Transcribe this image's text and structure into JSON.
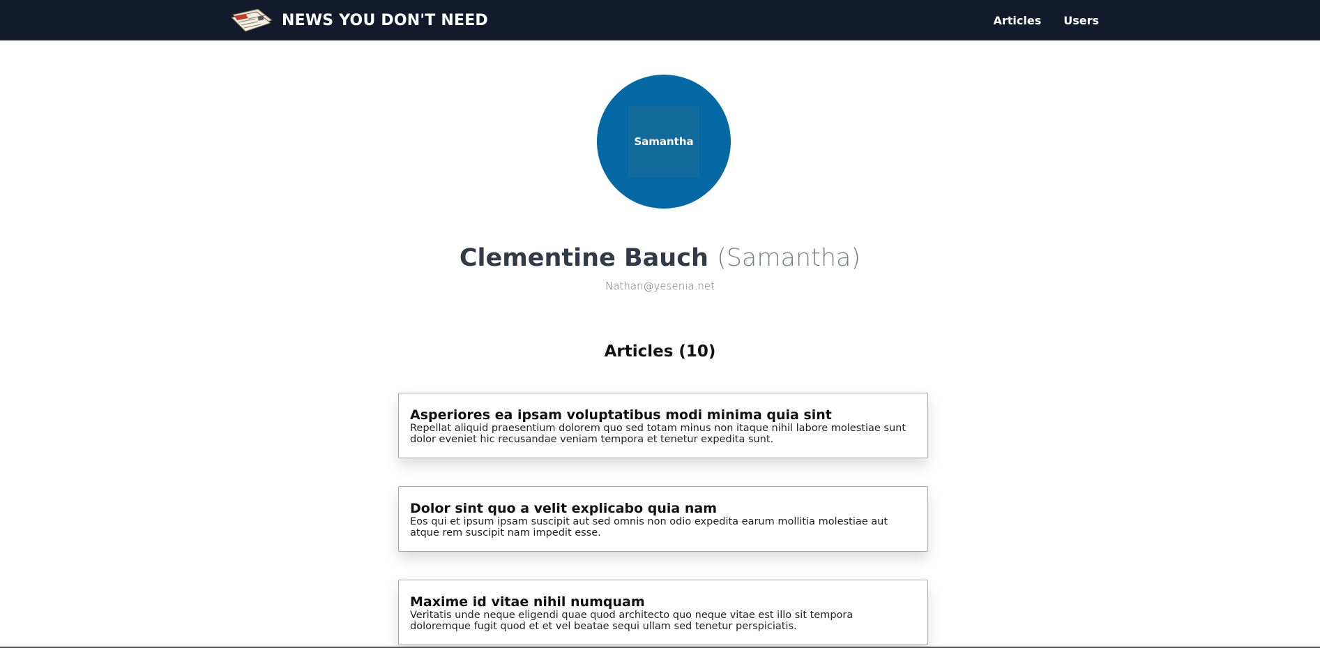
{
  "header": {
    "brand_title": "NEWS YOU DON'T NEED",
    "logo_icon": "newspaper-icon",
    "nav": [
      {
        "label": "Articles"
      },
      {
        "label": "Users"
      }
    ],
    "background_color": "#121a2b"
  },
  "profile": {
    "avatar_text": "Samantha",
    "avatar_color": "#0468a4",
    "name": "Clementine Bauch",
    "username": "(Samantha)",
    "email": "Nathan@yesenia.net"
  },
  "articles_section": {
    "title": "Articles (10)"
  },
  "articles": [
    {
      "title": "Asperiores ea ipsam voluptatibus modi minima quia sint",
      "body": "Repellat aliquid praesentium dolorem quo sed totam minus non itaque nihil labore molestiae sunt dolor eveniet hic recusandae veniam tempora et tenetur expedita sunt."
    },
    {
      "title": "Dolor sint quo a velit explicabo quia nam",
      "body": "Eos qui et ipsum ipsam suscipit aut sed omnis non odio expedita earum mollitia molestiae aut atque rem suscipit nam impedit esse."
    },
    {
      "title": "Maxime id vitae nihil numquam",
      "body": "Veritatis unde neque eligendi quae quod architecto quo neque vitae est illo sit tempora doloremque fugit quod et et vel beatae sequi ullam sed tenetur perspiciatis."
    }
  ]
}
